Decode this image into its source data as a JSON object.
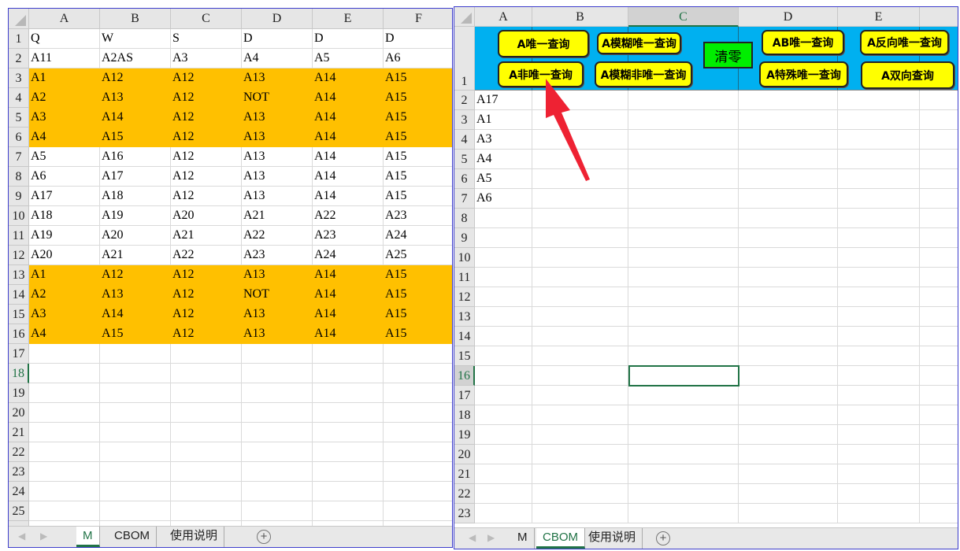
{
  "left_sheet": {
    "columns": [
      "A",
      "B",
      "C",
      "D",
      "E",
      "F"
    ],
    "rows": [
      [
        "Q",
        "W",
        "S",
        "D",
        "D",
        "D"
      ],
      [
        "A11",
        "A2AS",
        "A3",
        "A4",
        "A5",
        "A6"
      ],
      [
        "A1",
        "A12",
        "A12",
        "A13",
        "A14",
        "A15"
      ],
      [
        "A2",
        "A13",
        "A12",
        "NOT",
        "A14",
        "A15"
      ],
      [
        "A3",
        "A14",
        "A12",
        "A13",
        "A14",
        "A15"
      ],
      [
        "A4",
        "A15",
        "A12",
        "A13",
        "A14",
        "A15"
      ],
      [
        "A5",
        "A16",
        "A12",
        "A13",
        "A14",
        "A15"
      ],
      [
        "A6",
        "A17",
        "A12",
        "A13",
        "A14",
        "A15"
      ],
      [
        "A17",
        "A18",
        "A12",
        "A13",
        "A14",
        "A15"
      ],
      [
        "A18",
        "A19",
        "A20",
        "A21",
        "A22",
        "A23"
      ],
      [
        "A19",
        "A20",
        "A21",
        "A22",
        "A23",
        "A24"
      ],
      [
        "A20",
        "A21",
        "A22",
        "A23",
        "A24",
        "A25"
      ],
      [
        "A1",
        "A12",
        "A12",
        "A13",
        "A14",
        "A15"
      ],
      [
        "A2",
        "A13",
        "A12",
        "NOT",
        "A14",
        "A15"
      ],
      [
        "A3",
        "A14",
        "A12",
        "A13",
        "A14",
        "A15"
      ],
      [
        "A4",
        "A15",
        "A12",
        "A13",
        "A14",
        "A15"
      ]
    ],
    "highlighted_rows": [
      3,
      4,
      5,
      6,
      13,
      14,
      15,
      16
    ],
    "highlight_color": "#FFC000",
    "row_count": 26,
    "active_row": 18,
    "tabs": [
      "M",
      "CBOM",
      "使用说明"
    ],
    "active_tab": "M"
  },
  "right_sheet": {
    "columns": [
      "A",
      "B",
      "C",
      "D",
      "E"
    ],
    "header_fill": "#00B0F0",
    "buttons": [
      "A唯一查询",
      "A模糊唯一查询",
      "AB唯一查询",
      "A反向唯一查询",
      "A非唯一查询",
      "A模糊非唯一查询",
      "A特殊唯一查询",
      "A双向查询"
    ],
    "clear_button": "清零",
    "column_a": [
      "A17",
      "A1",
      "A3",
      "A4",
      "A5",
      "A6"
    ],
    "row_count": 23,
    "selected_cell": "C16",
    "tabs": [
      "M",
      "CBOM",
      "使用说明"
    ],
    "active_tab": "CBOM"
  },
  "colors": {
    "button": "#FFFF00",
    "clear": "#00EE00",
    "arrow": "#EE2233",
    "active_tab": "#217346"
  }
}
